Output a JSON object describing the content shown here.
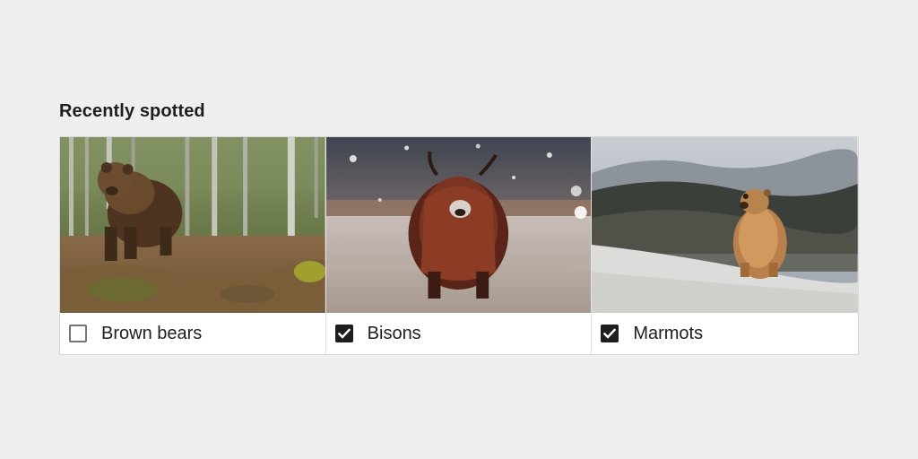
{
  "section": {
    "title": "Recently spotted"
  },
  "animals": [
    {
      "label": "Brown bears",
      "checked": false,
      "image_icon": "brown-bear-photo"
    },
    {
      "label": "Bisons",
      "checked": true,
      "image_icon": "bison-photo"
    },
    {
      "label": "Marmots",
      "checked": true,
      "image_icon": "marmot-photo"
    }
  ],
  "colors": {
    "background": "#efefef",
    "text": "#1e1e1e",
    "checkbox_checked": "#1e1e1e",
    "checkbox_border": "#757575"
  }
}
